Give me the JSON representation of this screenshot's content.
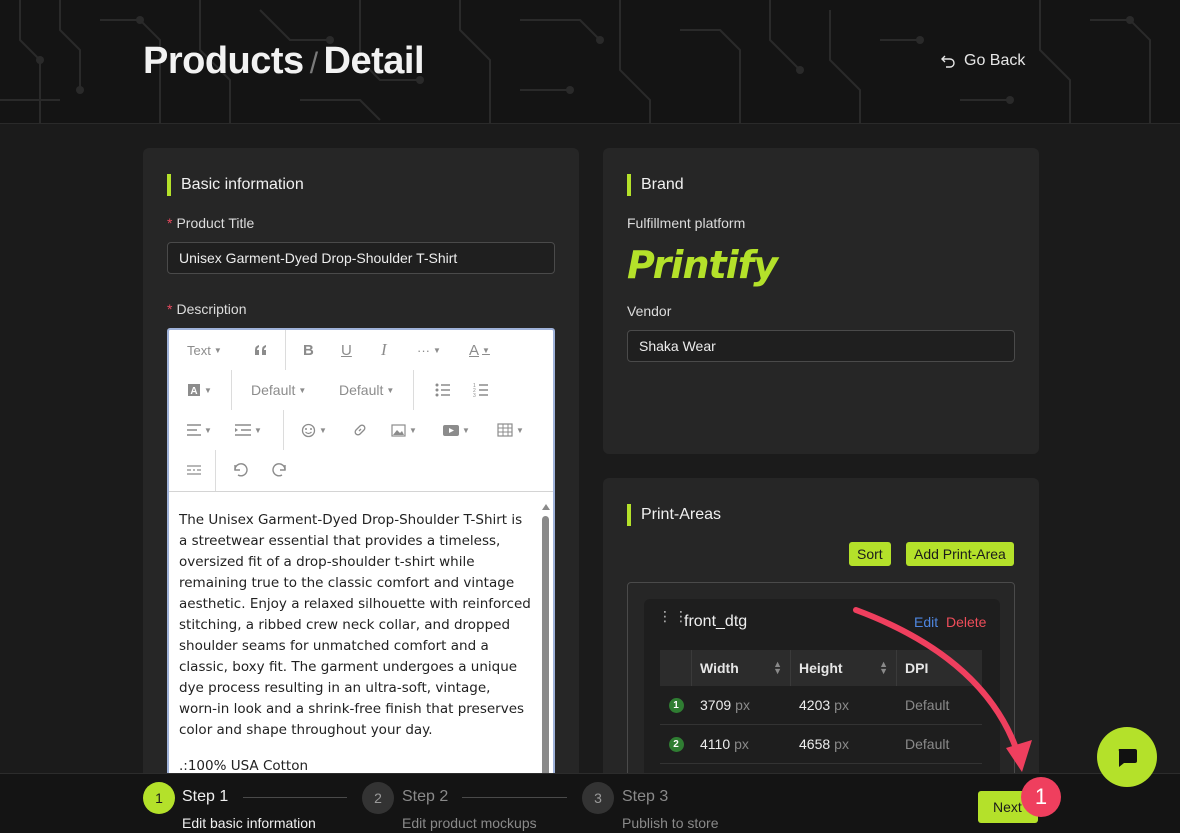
{
  "header": {
    "crumb_root": "Products",
    "crumb_sep": "/",
    "crumb_current": "Detail",
    "go_back": "Go Back"
  },
  "basic": {
    "title": "Basic information",
    "product_title_label": "Product Title",
    "product_title_value": "Unisex Garment-Dyed Drop-Shoulder T-Shirt",
    "description_label": "Description",
    "toolbar": {
      "text_format": "Text",
      "font_size": "Default",
      "line_height": "Default"
    },
    "description_paragraphs": [
      "The Unisex Garment-Dyed Drop-Shoulder T-Shirt is a streetwear essential that provides a timeless, oversized fit of a drop-shoulder t-shirt while remaining true to the classic comfort and vintage aesthetic. Enjoy a relaxed silhouette with reinforced stitching, a ribbed crew neck collar, and dropped shoulder seams for unmatched comfort and a classic, boxy fit. The garment undergoes a unique dye process resulting in an ultra-soft, vintage, worn-in look and a shrink-free finish that preserves color and shape throughout your day.",
      ".:100% USA Cotton"
    ]
  },
  "brand": {
    "title": "Brand",
    "platform_label": "Fulfillment platform",
    "platform_logo": "Printify",
    "vendor_label": "Vendor",
    "vendor_value": "Shaka Wear"
  },
  "print_areas": {
    "title": "Print-Areas",
    "sort_label": "Sort",
    "add_label": "Add Print-Area",
    "item": {
      "name": "front_dtg",
      "edit_label": "Edit",
      "delete_label": "Delete",
      "columns": [
        "Width",
        "Height",
        "DPI"
      ],
      "rows": [
        {
          "index": "1",
          "width": "3709",
          "height": "4203",
          "unit": "px",
          "dpi": "Default"
        },
        {
          "index": "2",
          "width": "4110",
          "height": "4658",
          "unit": "px",
          "dpi": "Default"
        }
      ]
    }
  },
  "steps": [
    {
      "number": "1",
      "title": "Step 1",
      "desc": "Edit basic information",
      "active": true
    },
    {
      "number": "2",
      "title": "Step 2",
      "desc": "Edit product mockups",
      "active": false
    },
    {
      "number": "3",
      "title": "Step 3",
      "desc": "Publish to store",
      "active": false
    }
  ],
  "next_label": "Next",
  "annotation_number": "1",
  "colors": {
    "accent": "#b4e12a",
    "danger": "#ee4d5a",
    "link": "#4e86e0",
    "annotation": "#ef3f5e"
  },
  "icons": [
    "undo-back-icon",
    "chat-icon",
    "drag-handle-icon",
    "sort-icon"
  ]
}
